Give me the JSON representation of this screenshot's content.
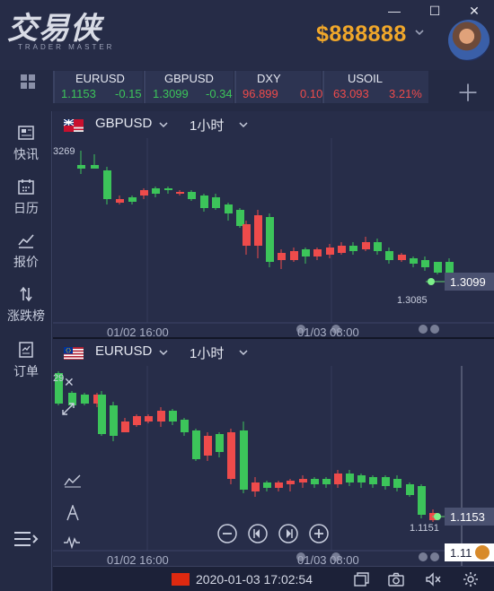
{
  "app": {
    "logo_text": "交易侠",
    "logo_subtitle": "TRADER MASTER",
    "balance": "$888888"
  },
  "window_controls": {
    "minimize": "—",
    "maximize": "☐",
    "close": "✕"
  },
  "quotes": [
    {
      "symbol": "EURUSD",
      "price": "1.1153",
      "change": "-0.15",
      "dir": "up"
    },
    {
      "symbol": "GBPUSD",
      "price": "1.3099",
      "change": "-0.34",
      "dir": "up"
    },
    {
      "symbol": "DXY",
      "price": "96.899",
      "change": "0.10",
      "dir": "down"
    },
    {
      "symbol": "USOIL",
      "price": "63.093",
      "change": "3.21%",
      "dir": "down"
    }
  ],
  "sidebar": [
    {
      "label": "快讯",
      "icon": "news-icon"
    },
    {
      "label": "日历",
      "icon": "calendar-icon"
    },
    {
      "label": "报价",
      "icon": "quote-trend-icon"
    },
    {
      "label": "涨跌榜",
      "icon": "updown-sort-icon"
    },
    {
      "label": "订单",
      "icon": "order-icon"
    }
  ],
  "charts": [
    {
      "symbol": "GBPUSD",
      "timeframe": "1小时",
      "flag": "uk-flag",
      "top_label": "3269",
      "low_label": "1.3085",
      "last_price": "1.3099",
      "x_labels": [
        "01/02 16:00",
        "01/03 08:00"
      ]
    },
    {
      "symbol": "EURUSD",
      "timeframe": "1小时",
      "flag": "us-flag",
      "top_label": "29",
      "low_label": "1.1151",
      "last_price": "1.1153",
      "cursor_price": "1.11",
      "x_labels": [
        "01/02 16:00",
        "01/03 08:00"
      ]
    }
  ],
  "status": {
    "datetime": "2020-01-03 17:02:54"
  },
  "colors": {
    "up": "#3cc45a",
    "down": "#ee4b4b",
    "accent": "#f0a72a",
    "bg": "#272d49"
  },
  "chart_data": [
    {
      "type": "candlestick",
      "symbol": "GBPUSD",
      "x": [
        "01/02 16:00",
        "01/03 08:00"
      ],
      "last": 1.3099,
      "low_marker": 1.3085
    },
    {
      "type": "candlestick",
      "symbol": "EURUSD",
      "x": [
        "01/02 16:00",
        "01/03 08:00"
      ],
      "last": 1.1153,
      "low_marker": 1.1151
    }
  ]
}
